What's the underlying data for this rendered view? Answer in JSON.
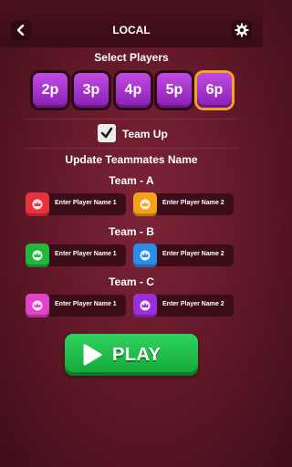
{
  "header": {
    "title": "LOCAL",
    "back_icon": "back-arrow-icon",
    "settings_icon": "gear-icon"
  },
  "select_players": {
    "label": "Select Players",
    "options": [
      "2p",
      "3p",
      "4p",
      "5p",
      "6p"
    ],
    "selected": "6p"
  },
  "team_up": {
    "label": "Team Up",
    "checked": true
  },
  "update_label": "Update Teammates Name",
  "teams": [
    {
      "title": "Team - A",
      "players": [
        {
          "placeholder": "Enter Player Name 1",
          "color": "#e8323c"
        },
        {
          "placeholder": "Enter Player Name 2",
          "color": "#f5a21a"
        }
      ]
    },
    {
      "title": "Team - B",
      "players": [
        {
          "placeholder": "Enter Player Name 1",
          "color": "#22b83e"
        },
        {
          "placeholder": "Enter Player Name 2",
          "color": "#2a8de8"
        }
      ]
    },
    {
      "title": "Team - C",
      "players": [
        {
          "placeholder": "Enter Player Name 1",
          "color": "#e044c8"
        },
        {
          "placeholder": "Enter Player Name 2",
          "color": "#9b2fd6"
        }
      ]
    }
  ],
  "play_button": {
    "label": "PLAY",
    "icon": "play-icon",
    "color": "#1fbf4a"
  }
}
